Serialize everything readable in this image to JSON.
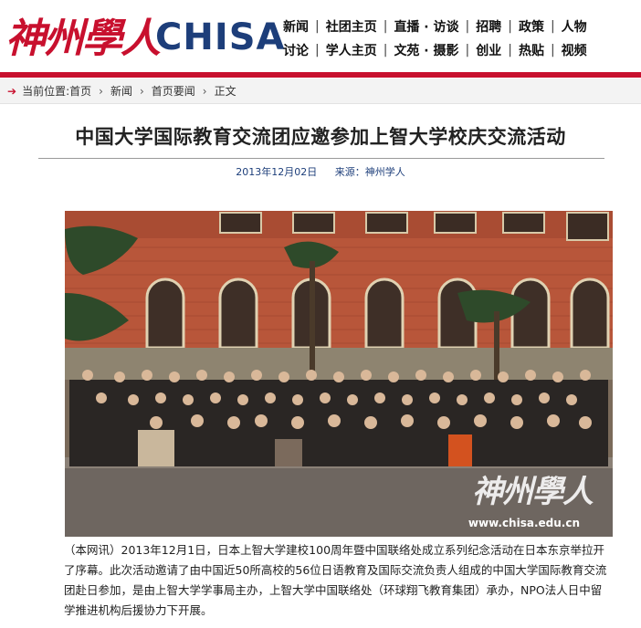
{
  "header": {
    "logo_cn": "神州學人",
    "logo_en": "CHISA",
    "nav_row1": [
      "新闻",
      "社团主页",
      "直播 · 访谈",
      "招聘",
      "政策",
      "人物"
    ],
    "nav_row2": [
      "讨论",
      "学人主页",
      "文苑 · 摄影",
      "创业",
      "热贴",
      "视频"
    ],
    "brand_color": "#c8102e",
    "logo_blue": "#1d3e7a"
  },
  "breadcrumb": {
    "prefix": "当前位置:",
    "items": [
      "首页",
      "新闻",
      "首页要闻",
      "正文"
    ]
  },
  "article": {
    "title": "中国大学国际教育交流团应邀参加上智大学校庆交流活动",
    "date": "2013年12月02日",
    "source": "来源：神州学人",
    "photo": {
      "watermark_cn": "神州學人",
      "watermark_url": "www.chisa.edu.cn"
    },
    "body": "（本网讯）2013年12月1日，日本上智大学建校100周年暨中国联络处成立系列纪念活动在日本东京举拉开了序幕。此次活动邀请了由中国近50所高校的56位日语教育及国际交流负责人组成的中国大学国际教育交流团赴日参加，是由上智大学学事局主办，上智大学中国联络处（环球翔飞教育集团）承办，NPO法人日中留学推进机构后援协力下开展。"
  }
}
